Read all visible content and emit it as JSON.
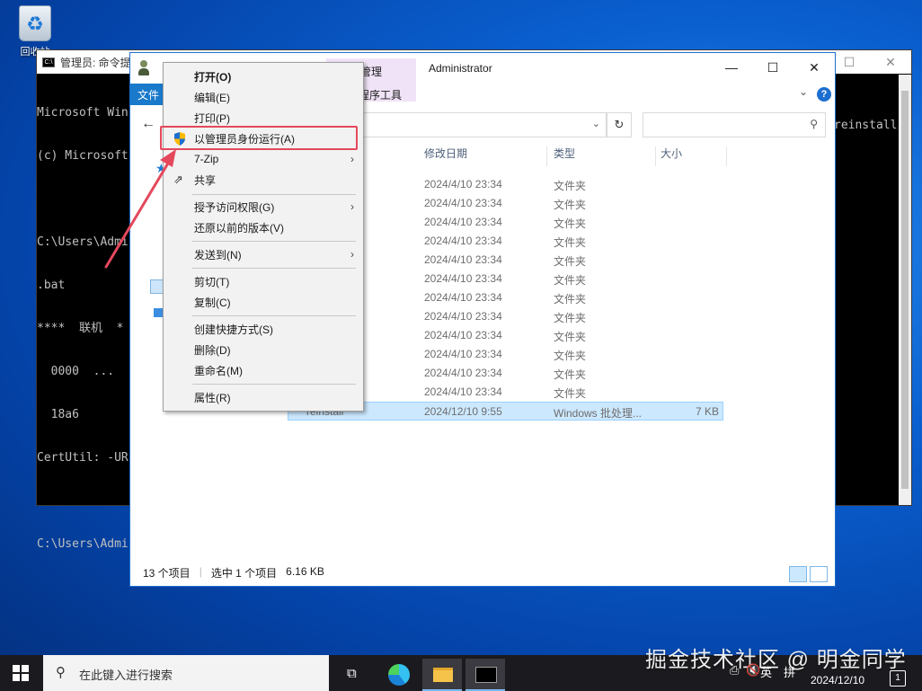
{
  "desktop": {
    "recycle_bin_label": "回收站"
  },
  "cmd": {
    "title": "管理员: 命令提示符",
    "lines": [
      "Microsoft Win",
      "(c) Microsoft",
      "",
      "C:\\Users\\Admi",
      ".bat",
      "****  联机  *",
      "  0000  ...",
      "  18a6",
      "CertUtil: -UR",
      "",
      "C:\\Users\\Admi"
    ],
    "right_text": "reinstall"
  },
  "explorer": {
    "title": "Administrator",
    "context_tab": "管理",
    "file_tab": "文件",
    "app_tools": "程序工具",
    "columns": {
      "date": "修改日期",
      "type": "类型",
      "size": "大小"
    },
    "rows": [
      {
        "name": "",
        "date": "2024/4/10 23:34",
        "type": "文件夹",
        "size": ""
      },
      {
        "name": "",
        "date": "2024/4/10 23:34",
        "type": "文件夹",
        "size": ""
      },
      {
        "name": "",
        "date": "2024/4/10 23:34",
        "type": "文件夹",
        "size": ""
      },
      {
        "name": "",
        "date": "2024/4/10 23:34",
        "type": "文件夹",
        "size": ""
      },
      {
        "name": "",
        "date": "2024/4/10 23:34",
        "type": "文件夹",
        "size": ""
      },
      {
        "name": "",
        "date": "2024/4/10 23:34",
        "type": "文件夹",
        "size": ""
      },
      {
        "name": "",
        "date": "2024/4/10 23:34",
        "type": "文件夹",
        "size": ""
      },
      {
        "name": "",
        "date": "2024/4/10 23:34",
        "type": "文件夹",
        "size": ""
      },
      {
        "name": "",
        "date": "2024/4/10 23:34",
        "type": "文件夹",
        "size": ""
      },
      {
        "name": "",
        "date": "2024/4/10 23:34",
        "type": "文件夹",
        "size": ""
      },
      {
        "name": "",
        "date": "2024/4/10 23:34",
        "type": "文件夹",
        "size": ""
      },
      {
        "name": "",
        "date": "2024/4/10 23:34",
        "type": "文件夹",
        "size": ""
      },
      {
        "name": "reinstall",
        "date": "2024/12/10 9:55",
        "type": "Windows 批处理...",
        "size": "7 KB",
        "selected": true
      }
    ],
    "status": {
      "count": "13 个项目",
      "selected": "选中 1 个项目",
      "size": "6.16 KB"
    }
  },
  "context_menu": {
    "items": [
      {
        "label": "打开(O)",
        "bold": true
      },
      {
        "label": "编辑(E)"
      },
      {
        "label": "打印(P)"
      },
      {
        "label": "以管理员身份运行(A)",
        "icon": "uac-shield-icon",
        "highlighted": true
      },
      {
        "label": "7-Zip",
        "submenu": true
      },
      {
        "label": "共享",
        "icon": "share-icon"
      },
      {
        "label": "授予访问权限(G)",
        "submenu": true
      },
      {
        "label": "还原以前的版本(V)"
      },
      {
        "label": "发送到(N)",
        "submenu": true
      },
      {
        "label": "剪切(T)"
      },
      {
        "label": "复制(C)"
      },
      {
        "label": "创建快捷方式(S)"
      },
      {
        "label": "删除(D)"
      },
      {
        "label": "重命名(M)"
      },
      {
        "label": "属性(R)"
      }
    ]
  },
  "taskbar": {
    "search_placeholder": "在此键入进行搜索",
    "ime": "英",
    "ime2": "拼",
    "date": "2024/12/10",
    "notification_count": "1"
  },
  "watermark": "掘金技术社区 @ 明金同学",
  "colors": {
    "highlight_box": "#e5485c",
    "selection": "#cce8ff",
    "accent": "#1979ca"
  }
}
